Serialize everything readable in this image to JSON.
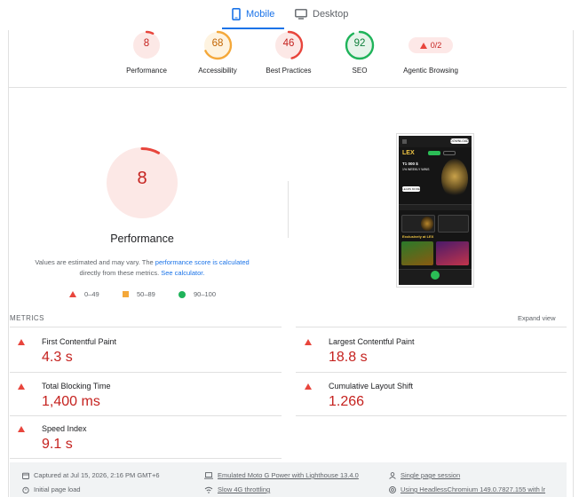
{
  "tabs": [
    {
      "label": "Mobile",
      "active": true,
      "icon": "smartphone-icon"
    },
    {
      "label": "Desktop",
      "active": false,
      "icon": "monitor-icon"
    }
  ],
  "scores": [
    {
      "label": "Performance",
      "value": "8",
      "score": 8,
      "color": "#e8453c",
      "ring": "#fce8e6",
      "text": "#c5221f"
    },
    {
      "label": "Accessibility",
      "value": "68",
      "score": 68,
      "color": "#f4a83a",
      "ring": "#fef3e0",
      "text": "#c26401"
    },
    {
      "label": "Best Practices",
      "value": "46",
      "score": 46,
      "color": "#e8453c",
      "ring": "#fce8e6",
      "text": "#c5221f"
    },
    {
      "label": "SEO",
      "value": "92",
      "score": 92,
      "color": "#1fb35a",
      "ring": "#e6f4ea",
      "text": "#0d7f3a"
    },
    {
      "label": "Agentic Browsing",
      "value": "0/2"
    }
  ],
  "performance": {
    "value": "8",
    "score": 8,
    "title": "Performance",
    "note_prefix": "Values are estimated and may vary. The ",
    "note_link": "performance score is calculated",
    "note_middle": "directly from these metrics. ",
    "note_link2": "See calculator.",
    "legend": [
      "0–49",
      "50–89",
      "90–100"
    ]
  },
  "metrics": {
    "title": "METRICS",
    "expand": "Expand view",
    "items": [
      {
        "name": "First Contentful Paint",
        "value": "4.3 s"
      },
      {
        "name": "Largest Contentful Paint",
        "value": "18.8 s"
      },
      {
        "name": "Total Blocking Time",
        "value": "1,400 ms"
      },
      {
        "name": "Cumulative Layout Shift",
        "value": "1.266"
      },
      {
        "name": "Speed Index",
        "value": "9.1 s"
      }
    ]
  },
  "footer": {
    "captured": "Captured at Jul 15, 2026, 2:16 PM GMT+6",
    "emulated": "Emulated Moto G Power with Lighthouse 13.4.0",
    "session": "Single page session",
    "initial": "Initial page load",
    "throttling": "Slow 4G throttling",
    "browser": "Using HeadlessChromium 149.0.7827.155 with lr"
  },
  "thumbnail": {
    "logo": "LEX",
    "download": "DOWNLOAD",
    "promo_line1": "T1 000 $",
    "promo_line2": "1% WEEKLY WINS",
    "cta": "LEARN MORE",
    "section": "Exclusively at LEX"
  }
}
